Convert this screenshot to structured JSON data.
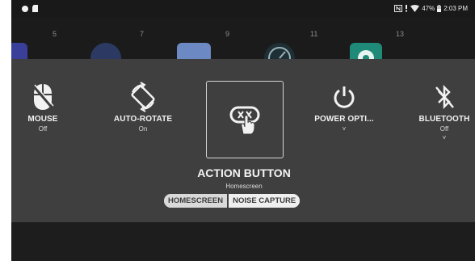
{
  "status_bar": {
    "battery_percent": "47%",
    "time": "2:03 PM",
    "icons": [
      "notification-dot-icon",
      "sd-card-icon",
      "nfc-icon",
      "signal-icon",
      "wifi-icon",
      "battery-icon"
    ]
  },
  "home": {
    "numbers": [
      "5",
      "7",
      "9",
      "11",
      "13"
    ],
    "app_colors": [
      "#3a3f9a",
      "#2c3a63",
      "#6d89c4",
      "#1f2f36",
      "#1f8a78"
    ]
  },
  "tiles": [
    {
      "id": "mouse",
      "label": "MOUSE",
      "sub": "Off",
      "icon": "mouse-icon"
    },
    {
      "id": "auto-rotate",
      "label": "AUTO-ROTATE",
      "sub": "On",
      "icon": "auto-rotate-icon"
    },
    {
      "id": "power",
      "label": "POWER OPTI...",
      "chevron": "˅",
      "icon": "power-icon"
    },
    {
      "id": "bluetooth",
      "label": "BLUETOOTH",
      "sub": "Off",
      "chevron": "˅",
      "icon": "bluetooth-off-icon"
    }
  ],
  "action": {
    "title": "ACTION BUTTON",
    "subtitle": "Homescreen",
    "icon": "gamepad-touch-icon",
    "options": [
      {
        "label": "HOMESCREEN",
        "active": true
      },
      {
        "label": "NOISE CAPTURE",
        "active": false
      }
    ]
  },
  "colors": {
    "panel": "#3f3f3f",
    "background": "#1c1c1c",
    "text": "#f2f2f2"
  }
}
